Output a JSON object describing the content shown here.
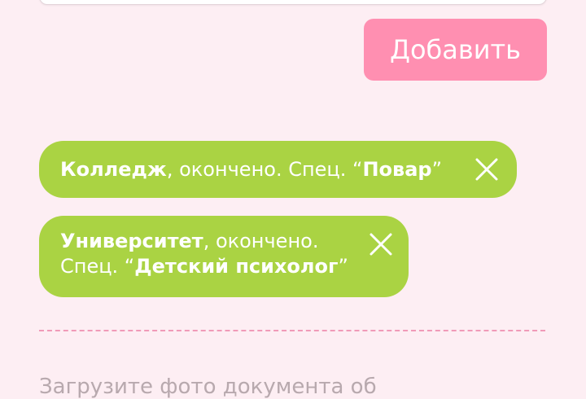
{
  "form": {
    "add_button_label": "Добавить"
  },
  "education_items": [
    {
      "institution": "Колледж",
      "status": ", окончено. Спец. “",
      "speciality": "Повар",
      "end": "”"
    },
    {
      "institution": "Университет",
      "status": ", окончено.",
      "spec_prefix": "Спец. “",
      "speciality": "Детский психолог",
      "end": "”"
    }
  ],
  "upload": {
    "prompt": "Загрузите фото документа об"
  },
  "colors": {
    "background": "#fdeef3",
    "button": "#ff8fb1",
    "chip": "#aad343",
    "divider": "#f09ab8"
  },
  "icons": {
    "remove": "close-icon"
  }
}
